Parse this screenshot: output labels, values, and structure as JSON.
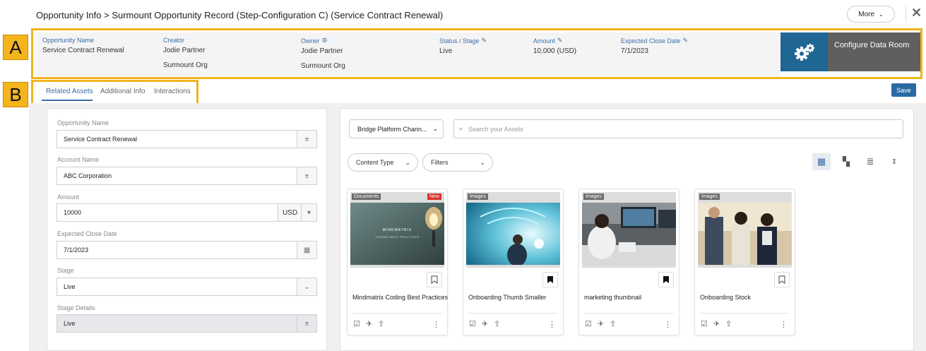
{
  "page": {
    "title": "Opportunity Info > Surmount Opportunity Record (Step-Configuration C) (Service Contract Renewal)",
    "more_label": "More",
    "close_symbol": "✕"
  },
  "callouts": {
    "a": "A",
    "b": "B"
  },
  "header": {
    "opportunity_name_label": "Opportunity Name",
    "opportunity_name": "Service Contract Renewal",
    "creator_label": "Creator",
    "creator_name": "Jodie Partner",
    "creator_org": "Surmount Org",
    "owner_label": "Owner",
    "owner_name": "Jodie Partner",
    "owner_org": "Surmount Org",
    "status_label": "Status / Stage",
    "status_value": "Live",
    "amount_label": "Amount",
    "amount_value": "10,000 (USD)",
    "close_date_label": "Expected Close Date",
    "close_date_value": "7/1/2023",
    "configure_label": "Configure Data Room",
    "accent_color": "#1f6694"
  },
  "tabs": [
    "Related Assets",
    "Additional Info",
    "Interactions"
  ],
  "save_label": "Save",
  "form": {
    "opportunity_name_label": "Opportunity Name",
    "opportunity_name_value": "Service Contract Renewal",
    "account_name_label": "Account Name",
    "account_name_value": "ABC Corporation",
    "amount_label": "Amount",
    "amount_value": "10000",
    "currency": "USD",
    "close_date_label": "Expected Close Date",
    "close_date_value": "7/1/2023",
    "stage_label": "Stage",
    "stage_value": "Live",
    "stage_details_label": "Stage Details",
    "stage_details_value": "Live"
  },
  "assets": {
    "channel_select": "Bridge Platform Chann...",
    "search_placeholder": "Search your Assets",
    "content_type_label": "Content Type",
    "filters_label": "Filters",
    "cards": [
      {
        "type": "Documents",
        "badge": "New",
        "title": "Mindmatrix Coding Best Practices",
        "bookmarked": false,
        "thumb_heading": "MINDMATRIX",
        "thumb_sub": "CODING BEST PRACTICES"
      },
      {
        "type": "Images",
        "badge": "",
        "title": "Onboarding Thumb Smaller",
        "bookmarked": true
      },
      {
        "type": "Images",
        "badge": "",
        "title": "marketing thumbnail",
        "bookmarked": true
      },
      {
        "type": "Images",
        "badge": "",
        "title": "Onboarding Stock",
        "bookmarked": false
      }
    ]
  }
}
